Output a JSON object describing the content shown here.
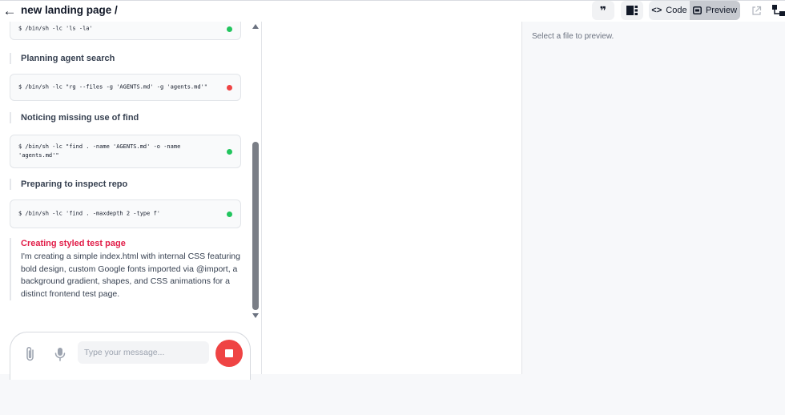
{
  "header": {
    "title": "new landing page /",
    "code_label": "Code",
    "preview_label": "Preview",
    "active_view": "Preview"
  },
  "chat": {
    "steps": [
      {
        "type": "command",
        "text": "$ /bin/sh -lc 'ls -la'",
        "status": "success"
      },
      {
        "type": "section",
        "title": "Planning agent search"
      },
      {
        "type": "command",
        "text": "$ /bin/sh -lc \"rg --files -g 'AGENTS.md' -g 'agents.md'\"",
        "status": "error"
      },
      {
        "type": "section",
        "title": "Noticing missing use of find"
      },
      {
        "type": "command",
        "text": "$ /bin/sh -lc \"find . -name 'AGENTS.md' -o -name\n'agents.md'\"",
        "status": "success"
      },
      {
        "type": "section",
        "title": "Preparing to inspect repo"
      },
      {
        "type": "command",
        "text": "$ /bin/sh -lc 'find . -maxdepth 2 -type f'",
        "status": "success"
      }
    ],
    "thought": {
      "title": "Creating styled test page",
      "body": "I'm creating a simple index.html with internal CSS featuring bold design, custom Google fonts imported via @import, a background gradient, shapes, and CSS animations for a distinct frontend test page."
    }
  },
  "composer": {
    "placeholder": "Type your message...",
    "value": ""
  },
  "preview": {
    "empty_text": "Select a file to preview."
  },
  "colors": {
    "success": "#22c55e",
    "error": "#ef4444",
    "thought_title": "#e11d48",
    "stop_button": "#ef4444"
  }
}
